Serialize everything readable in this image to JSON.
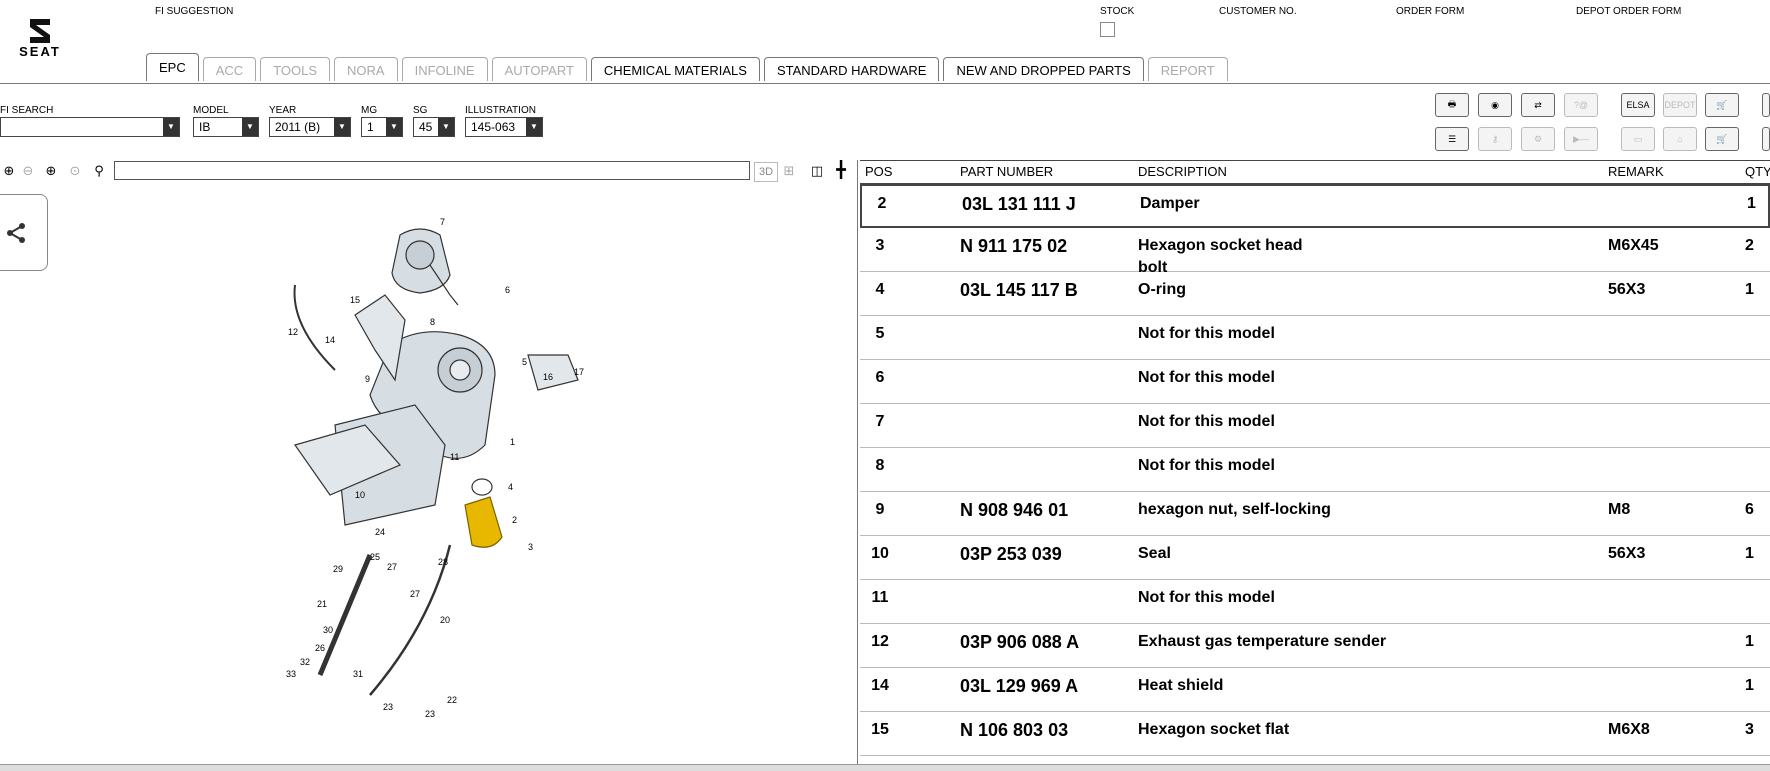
{
  "header": {
    "logo_text": "SEAT",
    "fi_suggestion": "FI SUGGESTION",
    "stock": "STOCK",
    "customer_no": "CUSTOMER NO.",
    "order_form": "ORDER FORM",
    "depot_order_form": "DEPOT ORDER FORM"
  },
  "tabs": [
    {
      "label": "EPC"
    },
    {
      "label": "ACC"
    },
    {
      "label": "TOOLS"
    },
    {
      "label": "NORA"
    },
    {
      "label": "INFOLINE"
    },
    {
      "label": "AUTOPART"
    },
    {
      "label": "CHEMICAL MATERIALS"
    },
    {
      "label": "STANDARD HARDWARE"
    },
    {
      "label": "NEW AND DROPPED PARTS"
    },
    {
      "label": "REPORT"
    }
  ],
  "filters": {
    "fi_search": {
      "label": "FI SEARCH",
      "value": ""
    },
    "model": {
      "label": "MODEL",
      "value": "IB"
    },
    "year": {
      "label": "YEAR",
      "value": "2011 (B)"
    },
    "mg": {
      "label": "MG",
      "value": "1"
    },
    "sg": {
      "label": "SG",
      "value": "45"
    },
    "illustration": {
      "label": "ILLUSTRATION",
      "value": "145-063"
    }
  },
  "toolbar": {
    "elsa": "ELSA",
    "depot": "DEPOT"
  },
  "zoom": {
    "label_3d": "3D"
  },
  "table": {
    "headers": {
      "pos": "POS",
      "part_number": "PART NUMBER",
      "description": "DESCRIPTION",
      "remark": "REMARK",
      "qty": "QTY"
    },
    "rows": [
      {
        "pos": "2",
        "part_number": "03L 131 111 J",
        "description": "Damper",
        "description2": "",
        "remark": "",
        "qty": "1"
      },
      {
        "pos": "3",
        "part_number": "N   911 175 02",
        "description": "Hexagon socket head",
        "description2": "bolt",
        "remark": "M6X45",
        "qty": "2"
      },
      {
        "pos": "4",
        "part_number": "03L 145 117 B",
        "description": "O-ring",
        "description2": "",
        "remark": "56X3",
        "qty": "1"
      },
      {
        "pos": "5",
        "part_number": "",
        "description": "Not for this model",
        "description2": "",
        "remark": "",
        "qty": ""
      },
      {
        "pos": "6",
        "part_number": "",
        "description": "Not for this model",
        "description2": "",
        "remark": "",
        "qty": ""
      },
      {
        "pos": "7",
        "part_number": "",
        "description": "Not for this model",
        "description2": "",
        "remark": "",
        "qty": ""
      },
      {
        "pos": "8",
        "part_number": "",
        "description": "Not for this model",
        "description2": "",
        "remark": "",
        "qty": ""
      },
      {
        "pos": "9",
        "part_number": "N   908 946 01",
        "description": "hexagon nut, self-locking",
        "description2": "",
        "remark": "M8",
        "qty": "6"
      },
      {
        "pos": "10",
        "part_number": "03P 253 039",
        "description": "Seal",
        "description2": "",
        "remark": "56X3",
        "qty": "1"
      },
      {
        "pos": "11",
        "part_number": "",
        "description": "Not for this model",
        "description2": "",
        "remark": "",
        "qty": ""
      },
      {
        "pos": "12",
        "part_number": "03P 906 088 A",
        "description": "Exhaust gas temperature sender",
        "description2": "",
        "remark": "",
        "qty": "1"
      },
      {
        "pos": "14",
        "part_number": "03L 129 969 A",
        "description": "Heat shield",
        "description2": "",
        "remark": "",
        "qty": "1"
      },
      {
        "pos": "15",
        "part_number": "N   106 803 03",
        "description": "Hexagon socket flat",
        "description2": "",
        "remark": "M6X8",
        "qty": "3"
      }
    ]
  },
  "diagram_labels": [
    "7",
    "6",
    "15",
    "8",
    "12",
    "14",
    "5",
    "16",
    "17",
    "9",
    "11",
    "1",
    "4",
    "2",
    "3",
    "10",
    "24",
    "25",
    "27",
    "28",
    "29",
    "21",
    "27",
    "30",
    "20",
    "26",
    "32",
    "33",
    "31",
    "23",
    "23",
    "22"
  ],
  "colors": {
    "highlight": "#e8b800",
    "accent": "#444444"
  }
}
